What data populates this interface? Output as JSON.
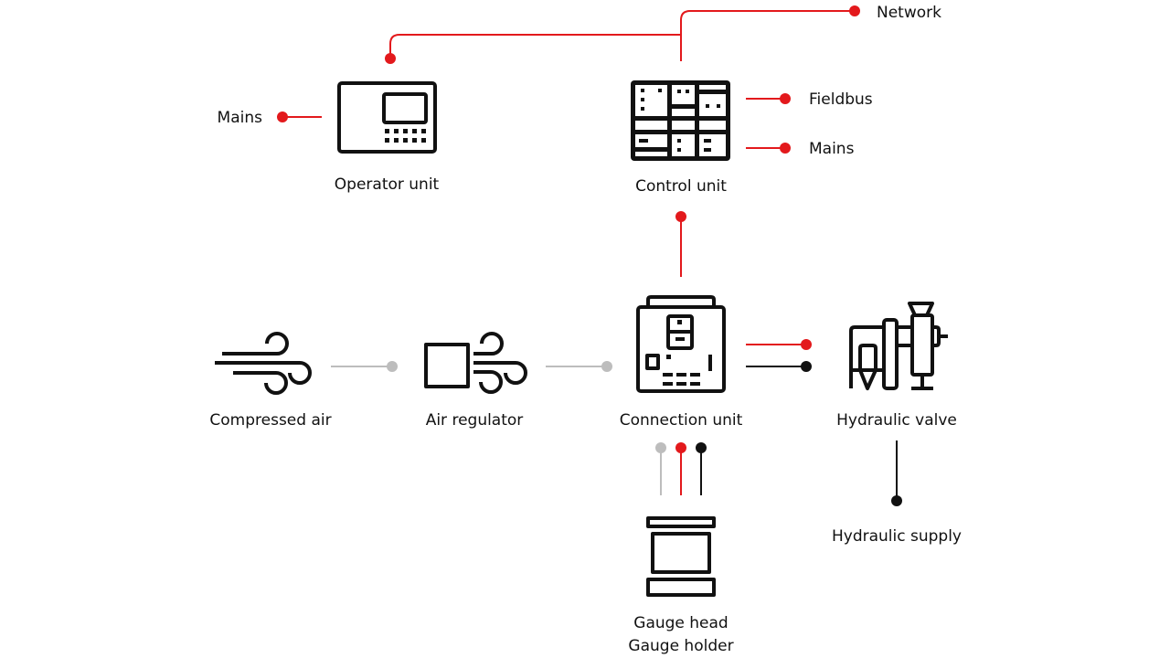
{
  "colors": {
    "electrical_line": "#e3191c",
    "pneumatic_line": "#bdbdbd",
    "hydraulic_line": "#111111",
    "icon": "#111111",
    "background": "#ffffff"
  },
  "nodes": {
    "operator_unit": {
      "label": "Operator unit",
      "icon": "operator-panel-icon"
    },
    "control_unit": {
      "label": "Control unit",
      "icon": "control-cabinet-icon"
    },
    "compressed_air": {
      "label": "Compressed air",
      "icon": "wind-icon"
    },
    "air_regulator": {
      "label": "Air regulator",
      "icon": "air-regulator-icon"
    },
    "connection_unit": {
      "label": "Connection unit",
      "icon": "connection-box-icon"
    },
    "hydraulic_valve": {
      "label": "Hydraulic valve",
      "icon": "hydraulic-valve-icon"
    },
    "gauge": {
      "label_line1": "Gauge head",
      "label_line2": "Gauge holder",
      "icon": "gauge-icon"
    }
  },
  "terminals": {
    "network": "Network",
    "operator_mains": "Mains",
    "fieldbus": "Fieldbus",
    "control_mains": "Mains",
    "hydraulic_supply": "Hydraulic supply"
  },
  "connections": [
    {
      "from": "Operator unit",
      "to": "Network",
      "color": "red"
    },
    {
      "from": "Control unit",
      "to": "Network",
      "color": "red"
    },
    {
      "from": "Mains",
      "to": "Operator unit",
      "color": "red"
    },
    {
      "from": "Control unit",
      "to": "Fieldbus",
      "color": "red"
    },
    {
      "from": "Control unit",
      "to": "Mains",
      "color": "red"
    },
    {
      "from": "Control unit",
      "to": "Connection unit",
      "color": "red"
    },
    {
      "from": "Compressed air",
      "to": "Air regulator",
      "color": "gray"
    },
    {
      "from": "Air regulator",
      "to": "Connection unit",
      "color": "gray"
    },
    {
      "from": "Connection unit",
      "to": "Hydraulic valve",
      "color": "red"
    },
    {
      "from": "Connection unit",
      "to": "Hydraulic valve",
      "color": "black"
    },
    {
      "from": "Hydraulic valve",
      "to": "Hydraulic supply",
      "color": "black"
    },
    {
      "from": "Connection unit",
      "to": "Gauge head / Gauge holder",
      "color": "gray"
    },
    {
      "from": "Connection unit",
      "to": "Gauge head / Gauge holder",
      "color": "red"
    },
    {
      "from": "Connection unit",
      "to": "Gauge head / Gauge holder",
      "color": "black"
    }
  ]
}
